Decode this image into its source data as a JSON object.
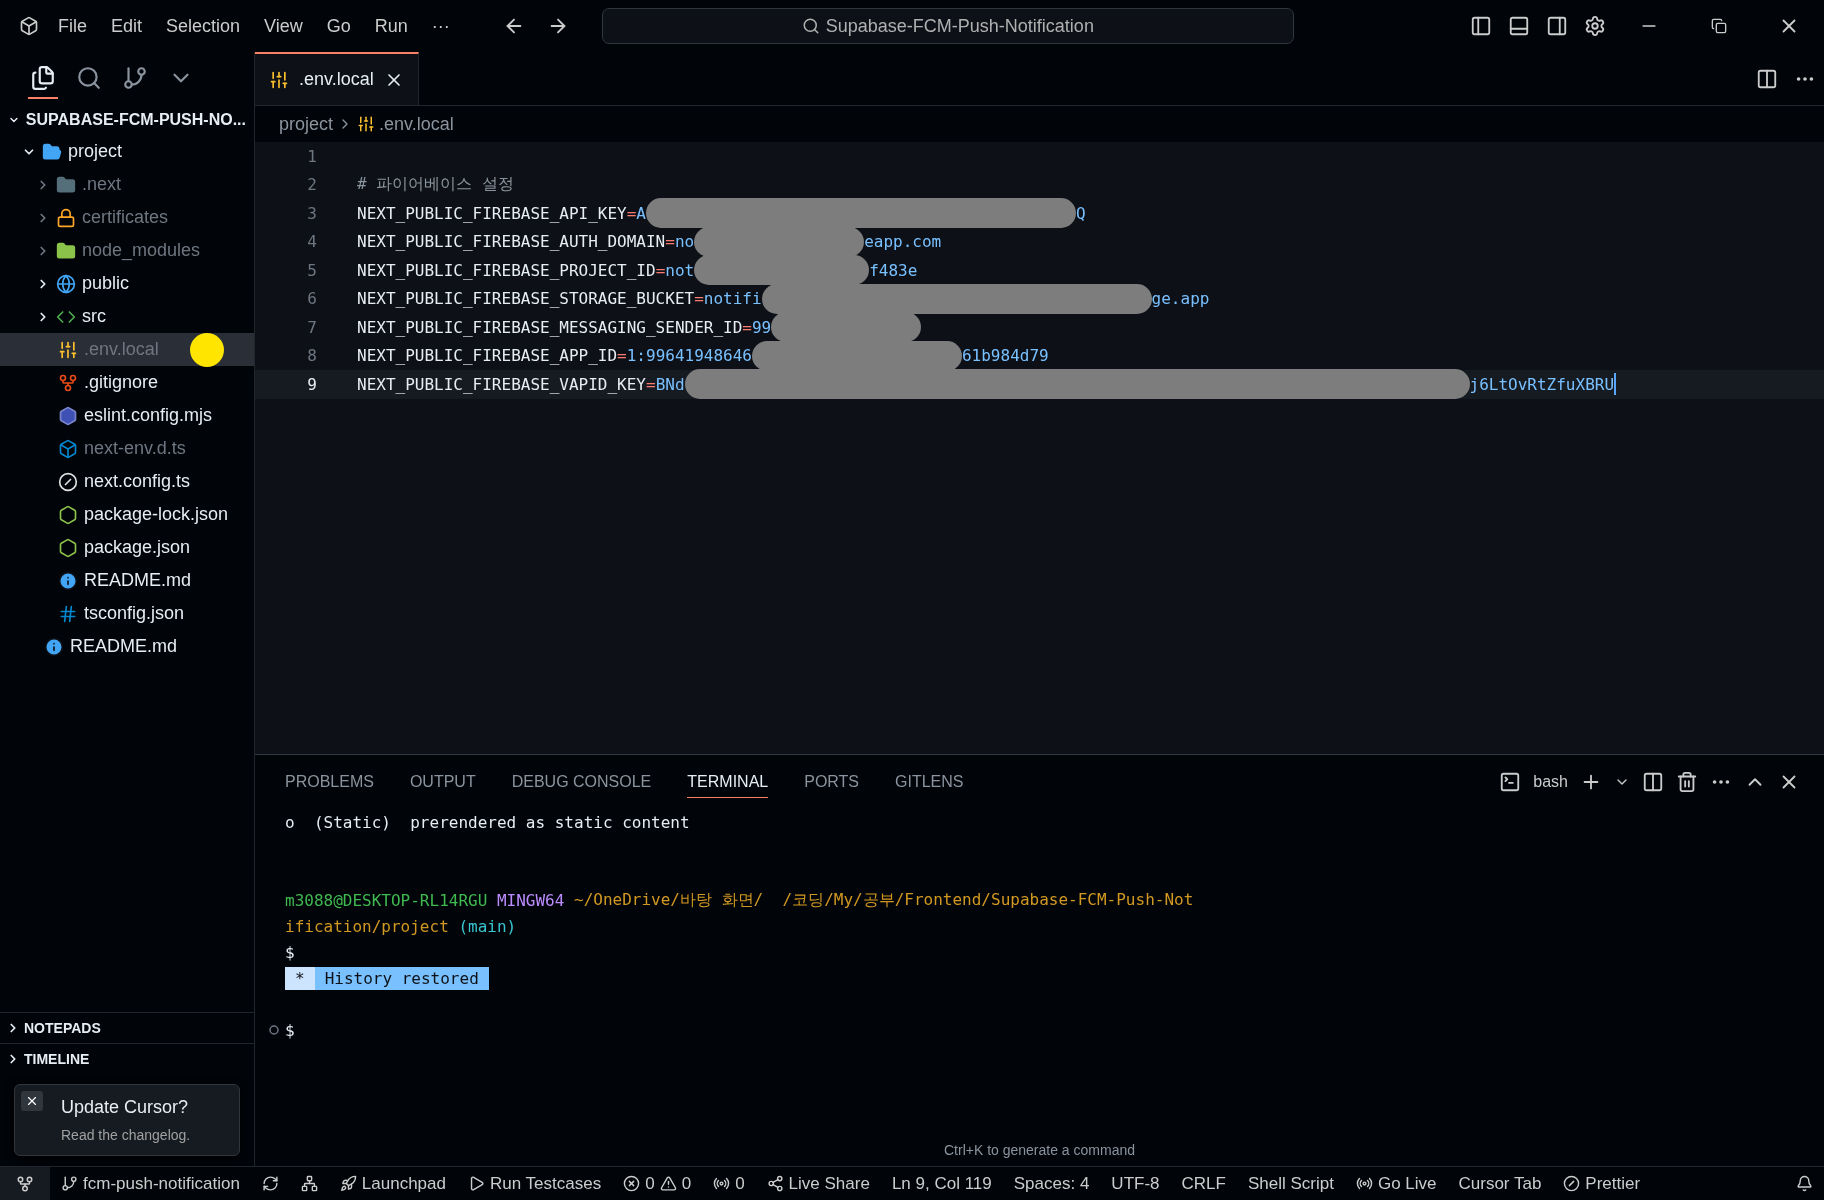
{
  "menu": [
    "File",
    "Edit",
    "Selection",
    "View",
    "Go",
    "Run",
    "···"
  ],
  "search": {
    "placeholder": "Supabase-FCM-Push-Notification"
  },
  "tabs": [
    {
      "label": ".env.local",
      "selected": true
    }
  ],
  "explorer": {
    "title": "SUPABASE-FCM-PUSH-NO...",
    "items": [
      {
        "label": "project",
        "kind": "project",
        "expanded": true,
        "dimmed": false,
        "selected": false,
        "children": [
          {
            "label": ".next",
            "kind": "next",
            "expanded": false,
            "dimmed": true,
            "selected": false
          },
          {
            "label": "certificates",
            "kind": "lock",
            "expanded": false,
            "dimmed": true,
            "selected": false
          },
          {
            "label": "node_modules",
            "kind": "node",
            "expanded": false,
            "dimmed": true,
            "selected": false
          },
          {
            "label": "public",
            "kind": "globe",
            "expanded": false,
            "dimmed": false,
            "selected": false
          },
          {
            "label": "src",
            "kind": "code",
            "expanded": false,
            "dimmed": false,
            "selected": false
          },
          {
            "label": ".env.local",
            "kind": "env",
            "dimmed": true,
            "selected": true
          },
          {
            "label": ".gitignore",
            "kind": "git",
            "dimmed": false,
            "selected": false
          },
          {
            "label": "eslint.config.mjs",
            "kind": "eslint",
            "dimmed": false,
            "selected": false
          },
          {
            "label": "next-env.d.ts",
            "kind": "ts",
            "dimmed": true,
            "selected": false
          },
          {
            "label": "next.config.ts",
            "kind": "n",
            "dimmed": false,
            "selected": false
          },
          {
            "label": "package-lock.json",
            "kind": "js",
            "dimmed": false,
            "selected": false
          },
          {
            "label": "package.json",
            "kind": "js",
            "dimmed": false,
            "selected": false
          },
          {
            "label": "README.md",
            "kind": "info",
            "dimmed": false,
            "selected": false
          },
          {
            "label": "tsconfig.json",
            "kind": "tsconfig",
            "dimmed": false,
            "selected": false
          }
        ]
      },
      {
        "label": "README.md",
        "kind": "info",
        "dimmed": false,
        "selected": false
      }
    ],
    "sections": [
      "NOTEPADS",
      "TIMELINE"
    ]
  },
  "breadcrumb": [
    "project",
    ".env.local"
  ],
  "editor": {
    "lines": [
      {
        "number": "1",
        "kind": "blank"
      },
      {
        "number": "2",
        "kind": "comment",
        "text": "# 파이어베이스 설정"
      },
      {
        "number": "3",
        "kind": "entry",
        "key": "NEXT_PUBLIC_FIREBASE_API_KEY",
        "sign": "=",
        "value": "A",
        "suffix": "Q",
        "redacted": true
      },
      {
        "number": "4",
        "kind": "entry",
        "key": "NEXT_PUBLIC_FIREBASE_AUTH_DOMAIN",
        "sign": "=",
        "value": "no",
        "suffix": "eapp.com",
        "redacted": true
      },
      {
        "number": "5",
        "kind": "entry",
        "key": "NEXT_PUBLIC_FIREBASE_PROJECT_ID",
        "sign": "=",
        "value": "not",
        "suffix": "f483e",
        "redacted": true
      },
      {
        "number": "6",
        "kind": "entry",
        "key": "NEXT_PUBLIC_FIREBASE_STORAGE_BUCKET",
        "sign": "=",
        "value": "notifi",
        "suffix": "ge.app",
        "redacted": true
      },
      {
        "number": "7",
        "kind": "entry",
        "key": "NEXT_PUBLIC_FIREBASE_MESSAGING_SENDER_ID",
        "sign": "=",
        "value": "99",
        "redacted": true
      },
      {
        "number": "8",
        "kind": "entry",
        "key": "NEXT_PUBLIC_FIREBASE_APP_ID",
        "sign": "=",
        "value": "1:99641948646",
        "suffix": "61b984d79",
        "redacted": true
      },
      {
        "number": "9",
        "kind": "entry",
        "key": "NEXT_PUBLIC_FIREBASE_VAPID_KEY",
        "sign": "=",
        "value": "BNd",
        "suffix": "j6LtOvRtZfuXBRU",
        "redacted": true,
        "current": true
      }
    ]
  },
  "panel": {
    "tabs": [
      {
        "label": "PROBLEMS",
        "selected": false
      },
      {
        "label": "OUTPUT",
        "selected": false
      },
      {
        "label": "DEBUG CONSOLE",
        "selected": false
      },
      {
        "label": "TERMINAL",
        "selected": true
      },
      {
        "label": "PORTS",
        "selected": false
      },
      {
        "label": "GITLENS",
        "selected": false
      }
    ],
    "shell": "bash",
    "terminal": {
      "route_mark": "o",
      "route_info": "(Static)  prerendered as static content",
      "user": "m3088@DESKTOP-RL14RGU",
      "system": "MINGW64",
      "path": "~/OneDrive/바탕 화면/  /코딩/My/공부/Frontend/Supabase-FCM-Push-Not",
      "path_rest": "ification/project",
      "branch": "(main)",
      "prompt": "$",
      "history_mark": "*",
      "history": "History restored",
      "prompt2": "$"
    },
    "hint": "Ctrl+K to generate a command"
  },
  "toast": {
    "title": "Update Cursor?",
    "body": "Read the changelog."
  },
  "status_bar": [
    {
      "kind": "branch",
      "text": "fcm-push-notification"
    },
    {
      "kind": "sync"
    },
    {
      "kind": "graph"
    },
    {
      "kind": "rocket",
      "text": "Launchpad"
    },
    {
      "kind": "play",
      "text": "Run Testcases"
    },
    {
      "kind": "problems",
      "errors": "0",
      "warnings": "0"
    },
    {
      "kind": "radio",
      "text": "0"
    },
    {
      "kind": "share",
      "text": "Live Share"
    },
    {
      "kind": "plain",
      "text": "Ln 9, Col 119"
    },
    {
      "kind": "plain",
      "text": "Spaces: 4"
    },
    {
      "kind": "plain",
      "text": "UTF-8"
    },
    {
      "kind": "plain",
      "text": "CRLF"
    },
    {
      "kind": "plain",
      "text": "Shell Script"
    },
    {
      "kind": "live",
      "text": "Go Live"
    },
    {
      "kind": "plain",
      "text": "Cursor Tab"
    },
    {
      "kind": "prettier",
      "text": "Prettier"
    },
    {
      "kind": "bell"
    }
  ]
}
